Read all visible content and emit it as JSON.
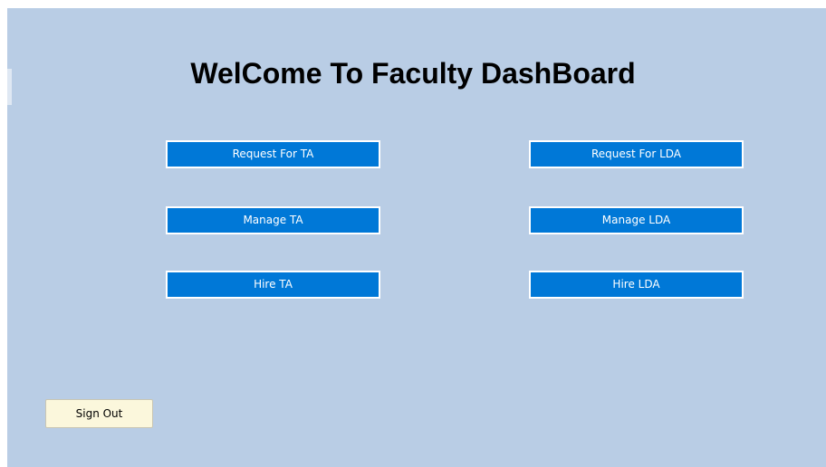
{
  "dashboard": {
    "title": "WelCome To Faculty DashBoard",
    "buttons": {
      "request_ta": "Request For TA",
      "request_lda": "Request For LDA",
      "manage_ta": "Manage TA",
      "manage_lda": "Manage LDA",
      "hire_ta": "Hire TA",
      "hire_lda": "Hire LDA"
    },
    "sign_out": "Sign Out"
  },
  "colors": {
    "background": "#b9cde5",
    "button_fill": "#0078d7",
    "button_text": "#ffffff",
    "sign_out_fill": "#fbf7dc"
  }
}
